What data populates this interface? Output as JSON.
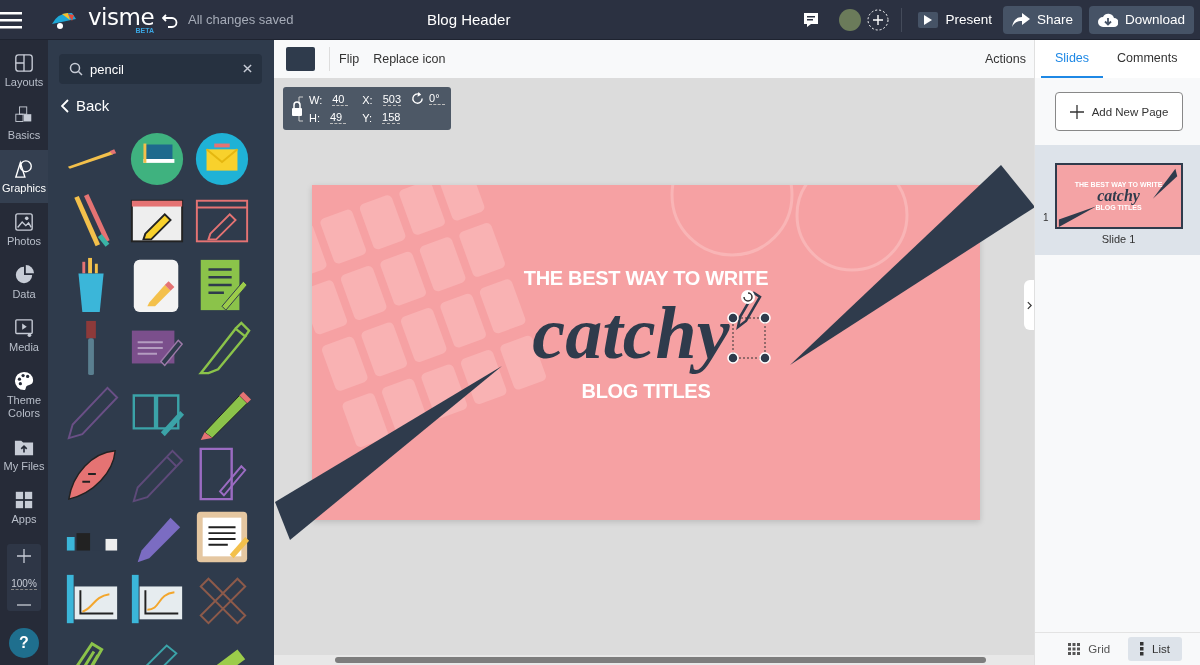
{
  "topbar": {
    "app_name": "visme",
    "badge": "BETA",
    "save_status": "All changes saved",
    "doc_title": "Blog Header",
    "buttons": [
      {
        "kind": "present",
        "label": "Present"
      },
      {
        "kind": "share",
        "label": "Share"
      },
      {
        "kind": "download",
        "label": "Download"
      }
    ]
  },
  "rail": {
    "items": [
      {
        "kind": "layouts",
        "label": "Layouts",
        "selected": false
      },
      {
        "kind": "basics",
        "label": "Basics",
        "selected": false
      },
      {
        "kind": "graphics",
        "label": "Graphics",
        "selected": true
      },
      {
        "kind": "photos",
        "label": "Photos",
        "selected": false
      },
      {
        "kind": "data",
        "label": "Data",
        "selected": false
      },
      {
        "kind": "media",
        "label": "Media",
        "selected": false
      },
      {
        "kind": "theme",
        "label": "Theme Colors",
        "selected": false
      },
      {
        "kind": "files",
        "label": "My Files",
        "selected": false
      },
      {
        "kind": "apps",
        "label": "Apps",
        "selected": false
      }
    ],
    "zoom": "100%",
    "help": "?"
  },
  "panel": {
    "search": {
      "value": "pencil"
    },
    "back": "Back"
  },
  "toolbar": {
    "items": [
      "Flip",
      "Replace icon"
    ],
    "actions": "Actions"
  },
  "properties": [
    {
      "label": "W:",
      "value": "40"
    },
    {
      "label": "X:",
      "value": "503"
    },
    {
      "label": "H:",
      "value": "49"
    },
    {
      "label": "Y:",
      "value": "158"
    }
  ],
  "rotation": "0°",
  "slide": {
    "lines": [
      {
        "kind": "heading",
        "text": "THE BEST WAY TO WRITE"
      },
      {
        "kind": "script",
        "text": "catchy"
      },
      {
        "kind": "heading",
        "text": "BLOG TITLES"
      }
    ]
  },
  "right_panel": {
    "tabs": [
      {
        "label": "Slides",
        "selected": true
      },
      {
        "label": "Comments",
        "selected": false
      }
    ],
    "add_button": "Add New Page",
    "slides": [
      {
        "number": "1",
        "label": "Slide 1",
        "selected": true,
        "thumb_lines": [
          "THE BEST WAY TO WRITE",
          "catchy",
          "BLOG TITLES"
        ]
      }
    ],
    "views": [
      {
        "kind": "grid",
        "label": "Grid",
        "selected": false
      },
      {
        "kind": "list",
        "label": "List",
        "selected": true
      }
    ]
  }
}
